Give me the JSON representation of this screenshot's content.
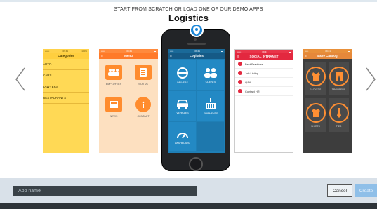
{
  "header": {
    "subtitle": "START FROM SCRATCH OR LOAD ONE OF OUR DEMO APPS",
    "title": "Logistics"
  },
  "carousel": {
    "prev_icon": "chevron-left-icon",
    "next_icon": "chevron-right-icon"
  },
  "apps": {
    "categories": {
      "status_left": "•••••• ",
      "status_time": "09:41",
      "status_right": "100%",
      "title": "Categories",
      "items": [
        "AUTO",
        "CARS",
        "LAWYERS",
        "RESTAURANTS"
      ]
    },
    "menu": {
      "status_time": "09:41",
      "title": "Menu",
      "tiles": [
        "EMPLOYEES",
        "STATUS",
        "NEWS",
        "CONTACT"
      ]
    },
    "logistics": {
      "status_time": "09:41",
      "title": "Logistics",
      "tiles": [
        "DRIVERS",
        "CLIENTS",
        "VEHICLES",
        "SHIPMENTS",
        "DASHBOARD"
      ]
    },
    "social": {
      "status_time": "09:41",
      "title": "SOCIAL INTRANET",
      "items": [
        "Best Practices",
        "Job Listing",
        "Q&A",
        "Contact HR"
      ]
    },
    "store": {
      "status_time": "09:41",
      "title": "Store Catalog",
      "tiles": [
        "JACKETS",
        "TROUSERS",
        "SHIRTS",
        "TIES"
      ]
    }
  },
  "footer": {
    "app_name_placeholder": "App name",
    "cancel_label": "Cancel",
    "create_label": "Create"
  },
  "colors": {
    "accent": "#1b86d8",
    "menu_orange": "#ff7a29",
    "social_red": "#e3283f",
    "categories_yellow": "#ffd955"
  }
}
